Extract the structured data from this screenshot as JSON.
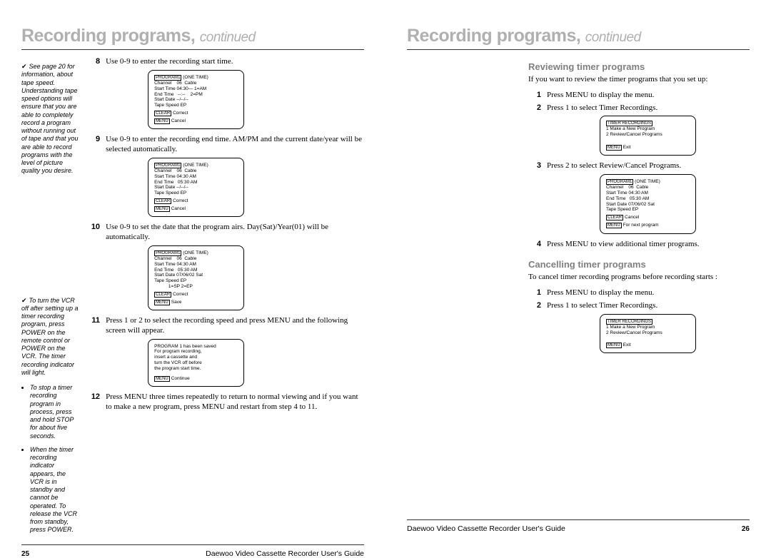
{
  "left": {
    "title_main": "Recording programs,",
    "title_sub": "continued",
    "sidebar": {
      "note1": "See page 20 for information, about tape speed. Understanding tape speed options will ensure that you are able to completely record a program without running out of tape and that you are able to record programs with the level of picture quality you desire.",
      "note2": "To turn the VCR off after setting up a timer recording program, press POWER on the remote control or POWER on the VCR. The timer recording indicator will light.",
      "bullets": [
        "To stop a timer recording program in process, press and hold STOP for about five seconds.",
        "When the timer recording indicator appears, the VCR is in standby and cannot be operated. To release the VCR from standby, press POWER."
      ]
    },
    "steps": [
      {
        "n": "8",
        "t": "Use 0-9 to enter the recording start time."
      },
      {
        "n": "9",
        "t": "Use 0-9 to enter the recording end time. AM/PM and the current date/year will be selected automatically."
      },
      {
        "n": "10",
        "t": "Use 0-9 to set the date that the program airs. Day(Sat)/Year(01) will be automatically."
      },
      {
        "n": "11",
        "t": "Press 1 or 2 to select the recording speed and press MENU and the following screen will appear."
      },
      {
        "n": "12",
        "t": "Press MENU three times repeatedly to return to normal viewing and if you want to make a new program, press MENU and restart from step 4 to 11."
      }
    ],
    "screens": {
      "s8": {
        "hd_box": "PROGRAM1",
        "hd_rest": " (ONE TIME)",
        "rows": [
          "Channel    06  Cable",
          "Start Time 04:30— 1=AM",
          "End Time   --:--    2=PM",
          "Start Date --/--/--",
          "Tape Speed EP"
        ],
        "ftr": [
          [
            "CLEAR",
            "Correct"
          ],
          [
            "MENU",
            "Cancel"
          ]
        ]
      },
      "s9": {
        "hd_box": "PROGRAM1",
        "hd_rest": " (ONE TIME)",
        "rows": [
          "Channel    06  Cable",
          "Start Time 04:30 AM",
          "End Time   05:30 AM",
          "Start Date --/--/--",
          "Tape Speed EP"
        ],
        "ftr": [
          [
            "CLEAR",
            "Correct"
          ],
          [
            "MENU",
            "Cancel"
          ]
        ]
      },
      "s10": {
        "hd_box": "PROGRAM1",
        "hd_rest": " (ONE TIME)",
        "rows": [
          "Channel    06  Cable",
          "Start Time 04:30 AM",
          "End Time   05:30 AM",
          "Start Date 07/06/02 Sat",
          "Tape Speed EP",
          "           1=SP 2=EP"
        ],
        "ftr": [
          [
            "CLEAR",
            "Correct"
          ],
          [
            "MENU",
            "Save"
          ]
        ]
      },
      "s11": {
        "rows": [
          "PROGRAM 1 has been saved",
          "",
          "For program recording,",
          "insert a cassette and",
          "turn the VCR off before",
          "the program start time."
        ],
        "ftr": [
          [
            "MENU",
            "Continue"
          ]
        ]
      }
    },
    "footer_page": "25",
    "footer_guide": "Daewoo Video Cassette Recorder User's Guide"
  },
  "right": {
    "title_main": "Recording programs,",
    "title_sub": "continued",
    "section1_head": "Reviewing timer programs",
    "section1_intro": "If you want to review the timer programs that you set up:",
    "section1_steps_a": [
      {
        "n": "1",
        "t": "Press MENU to display the menu."
      },
      {
        "n": "2",
        "t": "Press 1 to select Timer Recordings."
      }
    ],
    "screen_tr1": {
      "hd_box": "TIMER RECORDINGS",
      "rows": [
        "1 Make a New Program",
        "2 Review/Cancel Programs"
      ],
      "ftr": [
        [
          "MENU",
          "Exit"
        ]
      ]
    },
    "section1_step3": {
      "n": "3",
      "t": "Press 2 to select Review/Cancel Programs."
    },
    "screen_prog": {
      "hd_box": "PROGRAM1",
      "hd_rest": " (ONE TIME)",
      "rows": [
        "Channel    06  Cable",
        "Start Time 04:30 AM",
        "End Time   05:30 AM",
        "Start Date 07/06/02 Sat",
        "Tape Speed EP"
      ],
      "ftr": [
        [
          "CLEAR",
          "Cancel"
        ],
        [
          "MENU",
          "For next program"
        ]
      ]
    },
    "section1_step4": {
      "n": "4",
      "t": "Press MENU to view additional timer programs."
    },
    "section2_head": "Cancelling timer programs",
    "section2_intro": "To cancel timer recording programs before recording starts :",
    "section2_steps": [
      {
        "n": "1",
        "t": "Press MENU to display the menu."
      },
      {
        "n": "2",
        "t": "Press 1 to select Timer Recordings."
      }
    ],
    "screen_tr2": {
      "hd_box": "TIMER RECORDINGS",
      "rows": [
        "1 Make a New Program",
        "2 Review/Cancel Programs"
      ],
      "ftr": [
        [
          "MENU",
          "Exit"
        ]
      ]
    },
    "footer_page": "26",
    "footer_guide": "Daewoo Video Cassette Recorder User's Guide"
  }
}
